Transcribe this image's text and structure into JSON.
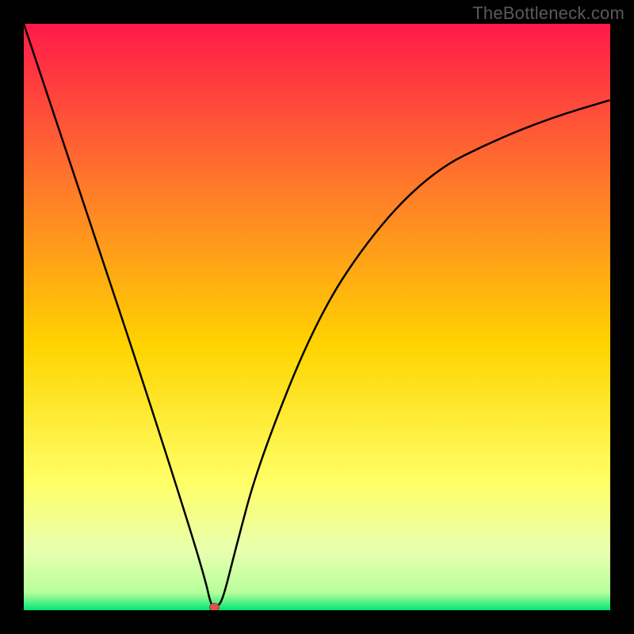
{
  "watermark": "TheBottleneck.com",
  "chart_data": {
    "type": "line",
    "title": "",
    "xlabel": "",
    "ylabel": "",
    "xlim": [
      0,
      100
    ],
    "ylim": [
      0,
      100
    ],
    "background_gradient": {
      "top": "#ff1a4a",
      "mid1": "#ff7a2a",
      "mid2": "#ffd400",
      "mid3": "#ffff66",
      "bottom_band": "#e8ffb0",
      "green_edge": "#00e676"
    },
    "series": [
      {
        "name": "bottleneck-curve",
        "description": "V-shaped bottleneck curve with a sharp minimum",
        "points": [
          {
            "x": 0,
            "y": 100
          },
          {
            "x": 10,
            "y": 70
          },
          {
            "x": 20,
            "y": 40
          },
          {
            "x": 28,
            "y": 15
          },
          {
            "x": 31,
            "y": 5
          },
          {
            "x": 32,
            "y": 0.5
          },
          {
            "x": 33,
            "y": 0.5
          },
          {
            "x": 34,
            "y": 2
          },
          {
            "x": 36,
            "y": 10
          },
          {
            "x": 40,
            "y": 25
          },
          {
            "x": 50,
            "y": 50
          },
          {
            "x": 60,
            "y": 65
          },
          {
            "x": 70,
            "y": 75
          },
          {
            "x": 80,
            "y": 80
          },
          {
            "x": 90,
            "y": 84
          },
          {
            "x": 100,
            "y": 87
          }
        ]
      }
    ],
    "marker": {
      "name": "minimum-point",
      "x": 32.5,
      "y": 0.5,
      "color": "#d9534f"
    }
  }
}
